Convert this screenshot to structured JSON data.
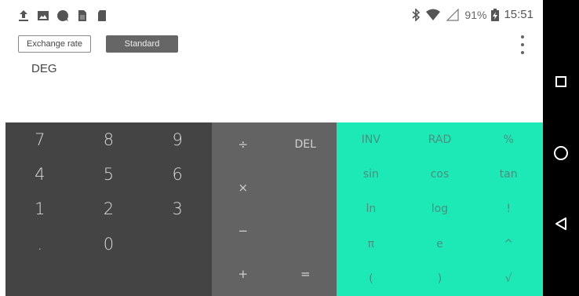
{
  "status_bar": {
    "battery": "91%",
    "time": "15:51",
    "notification_icons": [
      "upload-icon",
      "image-icon",
      "chat-bubble-icon",
      "sim-icon",
      "sd-card-icon"
    ]
  },
  "mode_buttons": {
    "exchange_rate": "Exchange rate",
    "standard": "Standard"
  },
  "display": {
    "angle_mode": "DEG"
  },
  "numpad": [
    "7",
    "8",
    "9",
    "4",
    "5",
    "6",
    "1",
    "2",
    "3",
    ".",
    "0",
    ""
  ],
  "ops": {
    "divide": "÷",
    "delete": "DEL",
    "multiply": "×",
    "minus": "−",
    "plus": "+",
    "equals": "="
  },
  "advanced": [
    "INV",
    "RAD",
    "%",
    "sin",
    "cos",
    "tan",
    "ln",
    "log",
    "!",
    "π",
    "e",
    "^",
    "(",
    ")",
    "√"
  ],
  "colors": {
    "numpad_bg": "#444444",
    "ops_bg": "#636363",
    "advanced_bg": "#1de9b6",
    "advanced_text": "#4a8f7e"
  }
}
